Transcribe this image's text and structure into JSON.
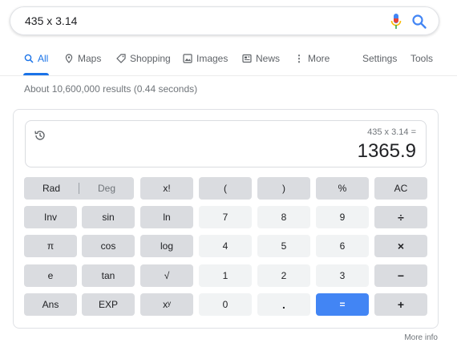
{
  "search": {
    "query": "435 x 3.14"
  },
  "tabs": [
    {
      "label": "All"
    },
    {
      "label": "Maps"
    },
    {
      "label": "Shopping"
    },
    {
      "label": "Images"
    },
    {
      "label": "News"
    },
    {
      "label": "More"
    },
    {
      "label": "Settings"
    },
    {
      "label": "Tools"
    }
  ],
  "result_stats": "About 10,600,000 results (0.44 seconds)",
  "calculator": {
    "expression": "435 x 3.14 =",
    "result": "1365.9",
    "mode_rad": "Rad",
    "mode_deg": "Deg",
    "keys": {
      "fact": "x!",
      "lparen": "(",
      "rparen": ")",
      "percent": "%",
      "ac": "AC",
      "inv": "Inv",
      "sin": "sin",
      "ln": "ln",
      "seven": "7",
      "eight": "8",
      "nine": "9",
      "divide": "÷",
      "pi": "π",
      "cos": "cos",
      "log": "log",
      "four": "4",
      "five": "5",
      "six": "6",
      "multiply": "×",
      "e": "e",
      "tan": "tan",
      "sqrt": "√",
      "one": "1",
      "two": "2",
      "three": "3",
      "minus": "−",
      "ans": "Ans",
      "exp": "EXP",
      "pow": "xʸ",
      "zero": "0",
      "dot": ".",
      "equals": "=",
      "plus": "+"
    }
  },
  "more_info": "More info",
  "colors": {
    "accent": "#1a73e8",
    "equals_button": "#4285f4",
    "operator_key": "#dadce0",
    "digit_key": "#f1f3f4"
  }
}
